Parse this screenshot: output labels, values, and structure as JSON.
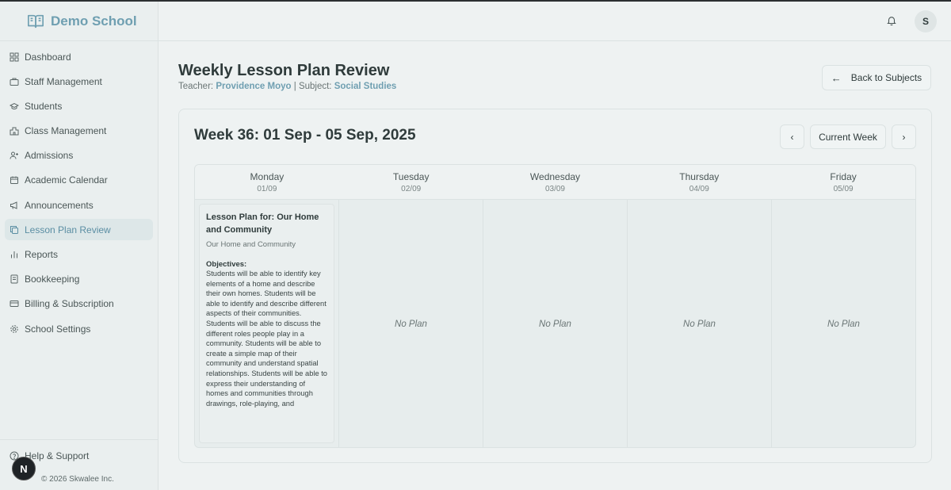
{
  "app": {
    "name": "Demo School"
  },
  "sidebar": {
    "items": [
      {
        "label": "Dashboard",
        "icon": "dashboard-icon"
      },
      {
        "label": "Staff Management",
        "icon": "briefcase-icon"
      },
      {
        "label": "Students",
        "icon": "graduation-cap-icon"
      },
      {
        "label": "Class Management",
        "icon": "school-icon"
      },
      {
        "label": "Admissions",
        "icon": "user-plus-icon"
      },
      {
        "label": "Academic Calendar",
        "icon": "calendar-icon"
      },
      {
        "label": "Announcements",
        "icon": "megaphone-icon"
      },
      {
        "label": "Lesson Plan Review",
        "icon": "copy-icon",
        "active": true
      },
      {
        "label": "Reports",
        "icon": "bar-chart-icon"
      },
      {
        "label": "Bookkeeping",
        "icon": "ledger-icon"
      },
      {
        "label": "Billing & Subscription",
        "icon": "credit-card-icon"
      },
      {
        "label": "School Settings",
        "icon": "gear-icon"
      }
    ],
    "help_label": "Help & Support",
    "copyright": "© 2026 Skwalee Inc.",
    "dev_badge": "N"
  },
  "header": {
    "avatar_initial": "S"
  },
  "page": {
    "title": "Weekly Lesson Plan Review",
    "teacher_label": "Teacher:",
    "teacher_name": "Providence Moyo",
    "separator": "|",
    "subject_label": "Subject:",
    "subject_name": "Social Studies",
    "back_label": "Back to Subjects"
  },
  "week": {
    "title": "Week 36: 01 Sep - 05 Sep, 2025",
    "current_label": "Current Week",
    "days": [
      {
        "name": "Monday",
        "date": "01/09"
      },
      {
        "name": "Tuesday",
        "date": "02/09"
      },
      {
        "name": "Wednesday",
        "date": "03/09"
      },
      {
        "name": "Thursday",
        "date": "04/09"
      },
      {
        "name": "Friday",
        "date": "05/09"
      }
    ],
    "no_plan_label": "No Plan",
    "plan": {
      "title": "Lesson Plan for: Our Home and Community",
      "subtitle": "Our Home and Community",
      "objectives_label": "Objectives:",
      "objectives_text": "Students will be able to identify key elements of a home and describe their own homes. Students will be able to identify and describe different aspects of their communities. Students will be able to discuss the different roles people play in a community. Students will be able to create a simple map of their community and understand spatial relationships. Students will be able to express their understanding of homes and communities through drawings, role-playing, and"
    }
  }
}
